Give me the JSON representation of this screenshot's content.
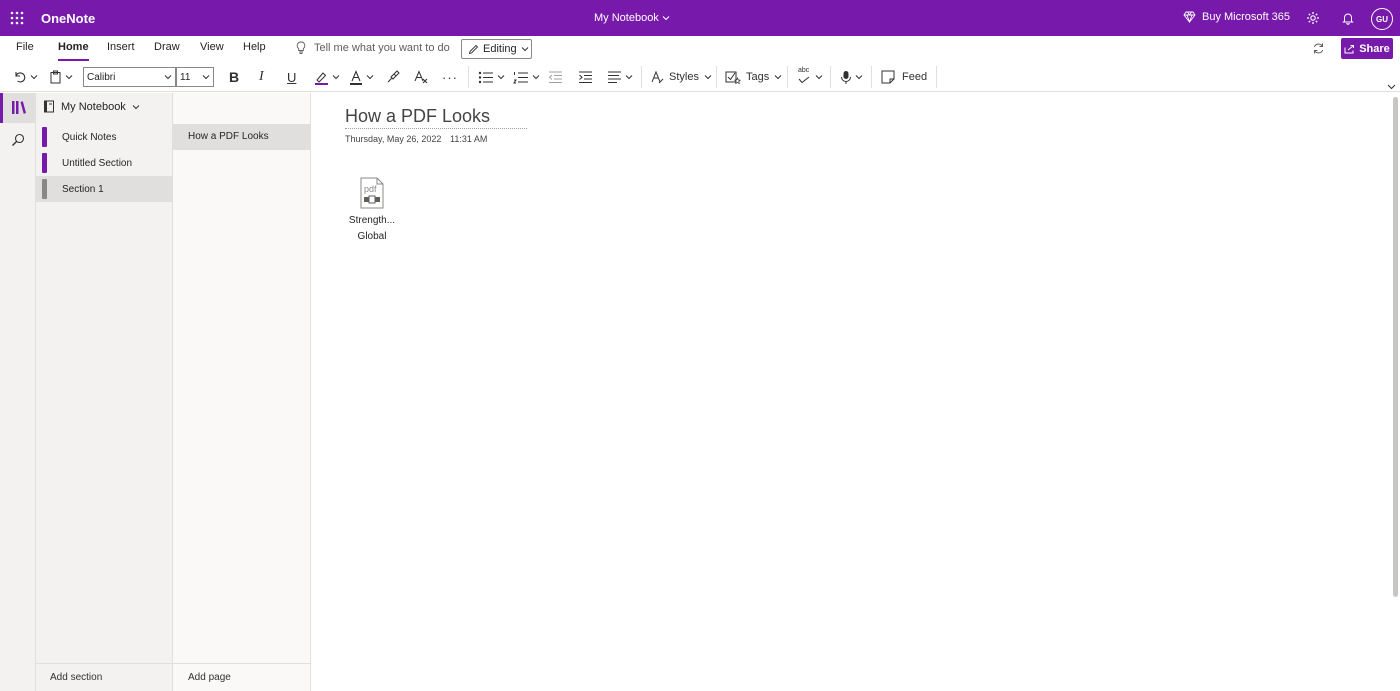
{
  "app": {
    "name": "OneNote",
    "notebook_title": "My Notebook",
    "buy_label": "Buy Microsoft 365",
    "user_initials": "GU",
    "brand_color": "#7719aa"
  },
  "menu": {
    "tabs": [
      "File",
      "Home",
      "Insert",
      "Draw",
      "View",
      "Help"
    ],
    "active_tab": "Home",
    "tell_me": "Tell me what you want to do",
    "mode": "Editing",
    "share_label": "Share"
  },
  "ribbon": {
    "font_family": "Calibri",
    "font_size": "11",
    "bold": "B",
    "italic": "I",
    "underline": "U",
    "more": "···",
    "styles_label": "Styles",
    "tags_label": "Tags",
    "spelling_label": "abc",
    "feed_label": "Feed"
  },
  "sidebar": {
    "notebook": "My Notebook",
    "sections": [
      {
        "label": "Quick Notes",
        "color": "#7719aa"
      },
      {
        "label": "Untitled Section",
        "color": "#7719aa"
      },
      {
        "label": "Section 1",
        "color": "#8a8886"
      }
    ],
    "selected_section": "Section 1",
    "add_section": "Add section"
  },
  "pages": {
    "items": [
      "How a PDF Looks"
    ],
    "add_page": "Add page"
  },
  "page": {
    "title": "How a PDF Looks",
    "date": "Thursday, May 26, 2022",
    "time": "11:31 AM",
    "attachment": {
      "icon": "pdf-file-icon",
      "icon_text": "pdf",
      "name_line1": "Strength...",
      "name_line2": "Global"
    }
  }
}
